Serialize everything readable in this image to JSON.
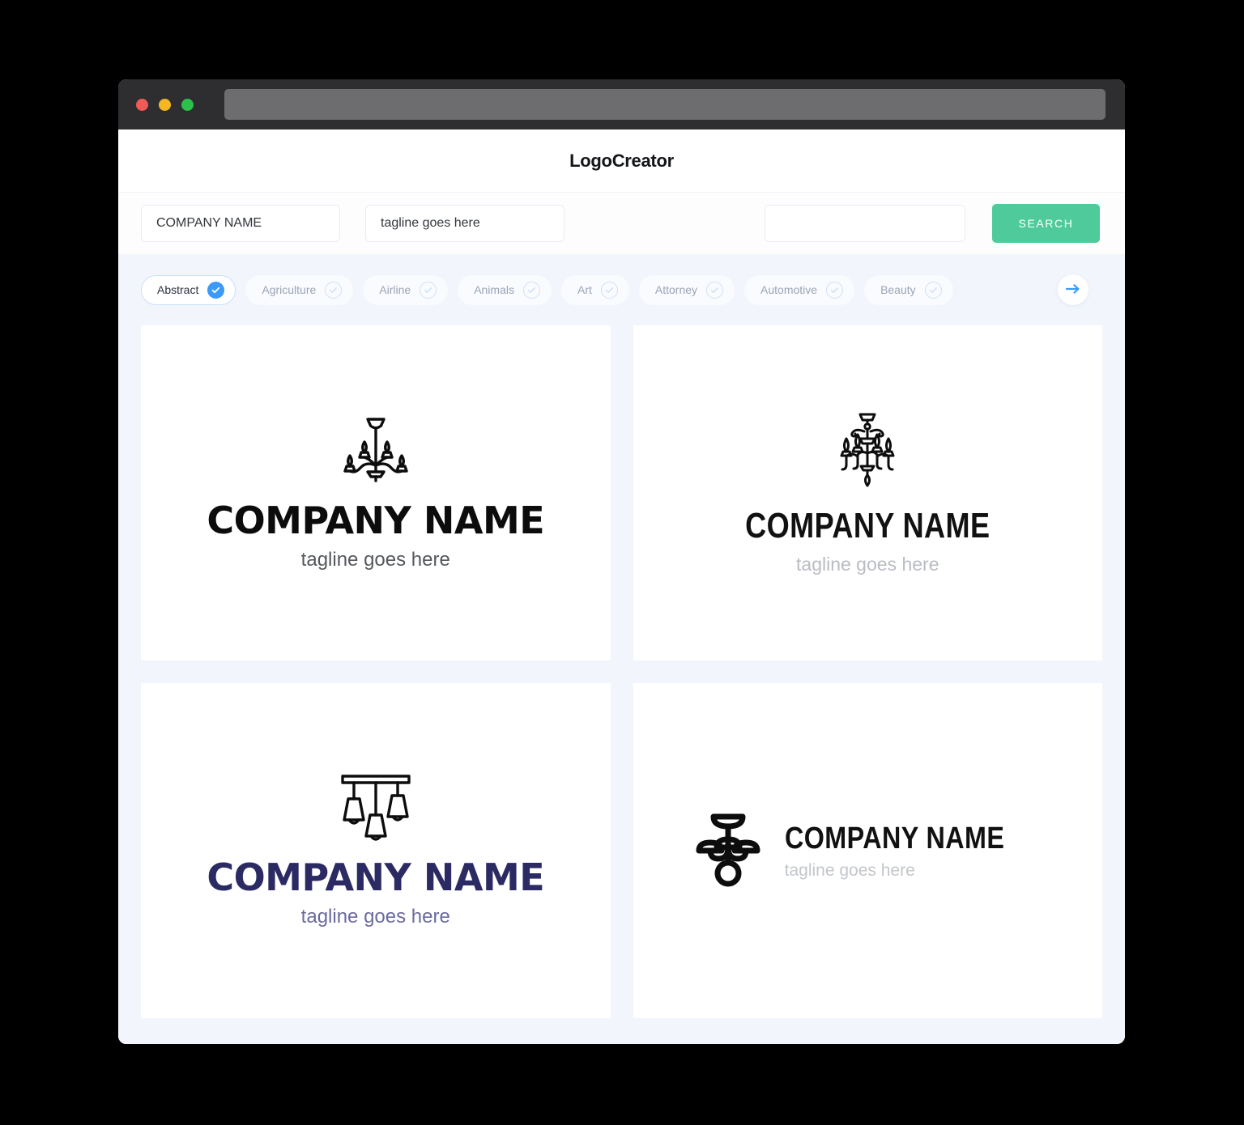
{
  "window": {
    "traffic_lights": [
      {
        "name": "close",
        "color": "#f05a56"
      },
      {
        "name": "minimize",
        "color": "#f5b624"
      },
      {
        "name": "maximize",
        "color": "#2dc14b"
      }
    ],
    "url_value": ""
  },
  "header": {
    "brand": "LogoCreator"
  },
  "search": {
    "company_value": "COMPANY NAME",
    "company_placeholder": "COMPANY NAME",
    "tagline_value": "tagline goes here",
    "tagline_placeholder": "tagline goes here",
    "keyword_value": "",
    "keyword_placeholder": "",
    "button_label": "SEARCH",
    "button_color": "#4fca9a"
  },
  "categories": {
    "next_icon": "arrow-right-icon",
    "accent_color": "#3b9af8",
    "items": [
      {
        "label": "Abstract",
        "selected": true
      },
      {
        "label": "Agriculture",
        "selected": false
      },
      {
        "label": "Airline",
        "selected": false
      },
      {
        "label": "Animals",
        "selected": false
      },
      {
        "label": "Art",
        "selected": false
      },
      {
        "label": "Attorney",
        "selected": false
      },
      {
        "label": "Automotive",
        "selected": false
      },
      {
        "label": "Beauty",
        "selected": false
      }
    ]
  },
  "results": [
    {
      "icon": "chandelier-thin-icon",
      "company_name": "COMPANY NAME",
      "tagline": "tagline goes here",
      "layout": "stacked",
      "name_color": "#0c0c0c",
      "tagline_color": "#55585e"
    },
    {
      "icon": "chandelier-ornate-icon",
      "company_name": "COMPANY NAME",
      "tagline": "tagline goes here",
      "layout": "stacked",
      "name_color": "#111111",
      "tagline_color": "#b9bcc2"
    },
    {
      "icon": "pendant-lamps-icon",
      "company_name": "COMPANY NAME",
      "tagline": "tagline goes here",
      "layout": "stacked",
      "name_color": "#2b2a63",
      "tagline_color": "#6b6aa0"
    },
    {
      "icon": "chandelier-bold-icon",
      "company_name": "COMPANY NAME",
      "tagline": "tagline goes here",
      "layout": "horizontal",
      "name_color": "#111111",
      "tagline_color": "#c3c6cb"
    }
  ]
}
